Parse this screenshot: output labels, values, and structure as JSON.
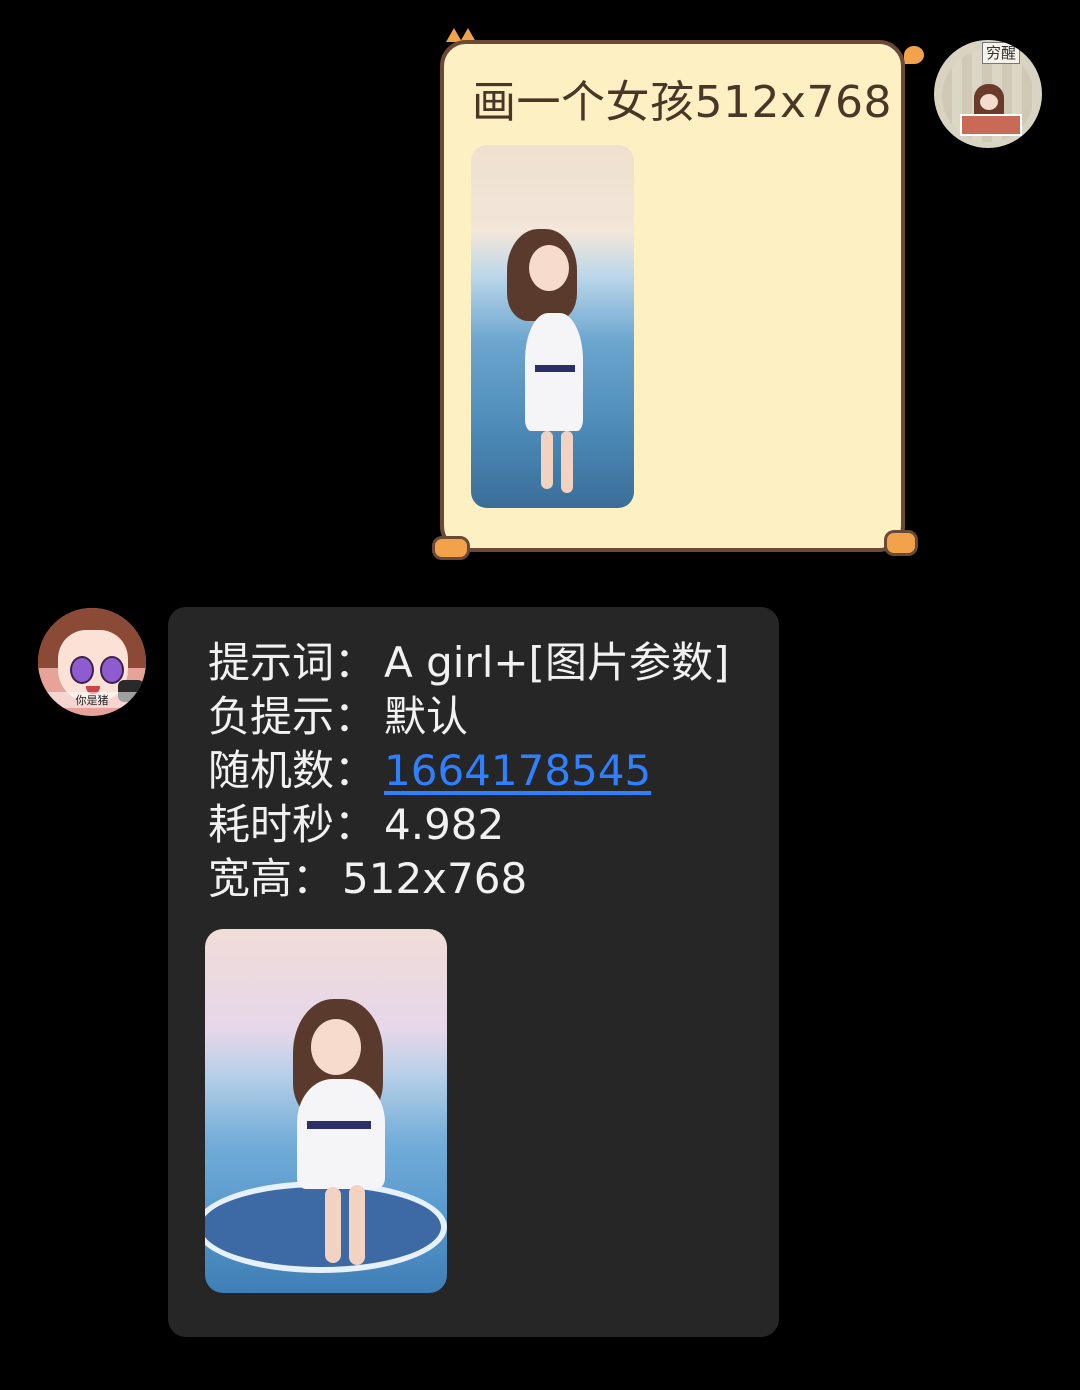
{
  "user_message": {
    "text": "画一个女孩512x768"
  },
  "user_avatar": {
    "label": "穷醒"
  },
  "bot_avatar": {
    "caption": "你是猪"
  },
  "bot_message": {
    "rows": [
      {
        "label": "提示词：",
        "value": "A girl+[图片参数]"
      },
      {
        "label": "负提示：",
        "value": "默认"
      },
      {
        "label": "随机数：",
        "value": "1664178545"
      },
      {
        "label": "耗时秒：",
        "value": "4.982"
      },
      {
        "label": "宽高：",
        "value": "512x768"
      }
    ]
  },
  "colors": {
    "background": "#000000",
    "user_bubble": "#fdf1c4",
    "bot_bubble": "#262626",
    "link": "#2f80ff"
  }
}
